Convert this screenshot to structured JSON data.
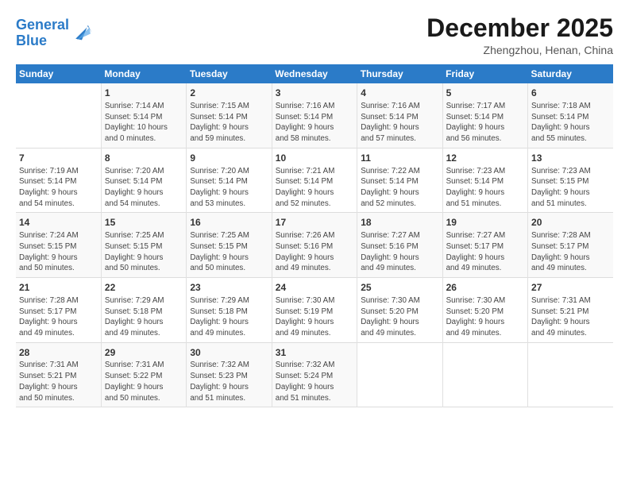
{
  "logo": {
    "line1": "General",
    "line2": "Blue"
  },
  "title": {
    "month_year": "December 2025",
    "location": "Zhengzhou, Henan, China"
  },
  "days_header": [
    "Sunday",
    "Monday",
    "Tuesday",
    "Wednesday",
    "Thursday",
    "Friday",
    "Saturday"
  ],
  "weeks": [
    [
      {
        "day": "",
        "info": ""
      },
      {
        "day": "1",
        "info": "Sunrise: 7:14 AM\nSunset: 5:14 PM\nDaylight: 10 hours\nand 0 minutes."
      },
      {
        "day": "2",
        "info": "Sunrise: 7:15 AM\nSunset: 5:14 PM\nDaylight: 9 hours\nand 59 minutes."
      },
      {
        "day": "3",
        "info": "Sunrise: 7:16 AM\nSunset: 5:14 PM\nDaylight: 9 hours\nand 58 minutes."
      },
      {
        "day": "4",
        "info": "Sunrise: 7:16 AM\nSunset: 5:14 PM\nDaylight: 9 hours\nand 57 minutes."
      },
      {
        "day": "5",
        "info": "Sunrise: 7:17 AM\nSunset: 5:14 PM\nDaylight: 9 hours\nand 56 minutes."
      },
      {
        "day": "6",
        "info": "Sunrise: 7:18 AM\nSunset: 5:14 PM\nDaylight: 9 hours\nand 55 minutes."
      }
    ],
    [
      {
        "day": "7",
        "info": "Sunrise: 7:19 AM\nSunset: 5:14 PM\nDaylight: 9 hours\nand 54 minutes."
      },
      {
        "day": "8",
        "info": "Sunrise: 7:20 AM\nSunset: 5:14 PM\nDaylight: 9 hours\nand 54 minutes."
      },
      {
        "day": "9",
        "info": "Sunrise: 7:20 AM\nSunset: 5:14 PM\nDaylight: 9 hours\nand 53 minutes."
      },
      {
        "day": "10",
        "info": "Sunrise: 7:21 AM\nSunset: 5:14 PM\nDaylight: 9 hours\nand 52 minutes."
      },
      {
        "day": "11",
        "info": "Sunrise: 7:22 AM\nSunset: 5:14 PM\nDaylight: 9 hours\nand 52 minutes."
      },
      {
        "day": "12",
        "info": "Sunrise: 7:23 AM\nSunset: 5:14 PM\nDaylight: 9 hours\nand 51 minutes."
      },
      {
        "day": "13",
        "info": "Sunrise: 7:23 AM\nSunset: 5:15 PM\nDaylight: 9 hours\nand 51 minutes."
      }
    ],
    [
      {
        "day": "14",
        "info": "Sunrise: 7:24 AM\nSunset: 5:15 PM\nDaylight: 9 hours\nand 50 minutes."
      },
      {
        "day": "15",
        "info": "Sunrise: 7:25 AM\nSunset: 5:15 PM\nDaylight: 9 hours\nand 50 minutes."
      },
      {
        "day": "16",
        "info": "Sunrise: 7:25 AM\nSunset: 5:15 PM\nDaylight: 9 hours\nand 50 minutes."
      },
      {
        "day": "17",
        "info": "Sunrise: 7:26 AM\nSunset: 5:16 PM\nDaylight: 9 hours\nand 49 minutes."
      },
      {
        "day": "18",
        "info": "Sunrise: 7:27 AM\nSunset: 5:16 PM\nDaylight: 9 hours\nand 49 minutes."
      },
      {
        "day": "19",
        "info": "Sunrise: 7:27 AM\nSunset: 5:17 PM\nDaylight: 9 hours\nand 49 minutes."
      },
      {
        "day": "20",
        "info": "Sunrise: 7:28 AM\nSunset: 5:17 PM\nDaylight: 9 hours\nand 49 minutes."
      }
    ],
    [
      {
        "day": "21",
        "info": "Sunrise: 7:28 AM\nSunset: 5:17 PM\nDaylight: 9 hours\nand 49 minutes."
      },
      {
        "day": "22",
        "info": "Sunrise: 7:29 AM\nSunset: 5:18 PM\nDaylight: 9 hours\nand 49 minutes."
      },
      {
        "day": "23",
        "info": "Sunrise: 7:29 AM\nSunset: 5:18 PM\nDaylight: 9 hours\nand 49 minutes."
      },
      {
        "day": "24",
        "info": "Sunrise: 7:30 AM\nSunset: 5:19 PM\nDaylight: 9 hours\nand 49 minutes."
      },
      {
        "day": "25",
        "info": "Sunrise: 7:30 AM\nSunset: 5:20 PM\nDaylight: 9 hours\nand 49 minutes."
      },
      {
        "day": "26",
        "info": "Sunrise: 7:30 AM\nSunset: 5:20 PM\nDaylight: 9 hours\nand 49 minutes."
      },
      {
        "day": "27",
        "info": "Sunrise: 7:31 AM\nSunset: 5:21 PM\nDaylight: 9 hours\nand 49 minutes."
      }
    ],
    [
      {
        "day": "28",
        "info": "Sunrise: 7:31 AM\nSunset: 5:21 PM\nDaylight: 9 hours\nand 50 minutes."
      },
      {
        "day": "29",
        "info": "Sunrise: 7:31 AM\nSunset: 5:22 PM\nDaylight: 9 hours\nand 50 minutes."
      },
      {
        "day": "30",
        "info": "Sunrise: 7:32 AM\nSunset: 5:23 PM\nDaylight: 9 hours\nand 51 minutes."
      },
      {
        "day": "31",
        "info": "Sunrise: 7:32 AM\nSunset: 5:24 PM\nDaylight: 9 hours\nand 51 minutes."
      },
      {
        "day": "",
        "info": ""
      },
      {
        "day": "",
        "info": ""
      },
      {
        "day": "",
        "info": ""
      }
    ]
  ]
}
